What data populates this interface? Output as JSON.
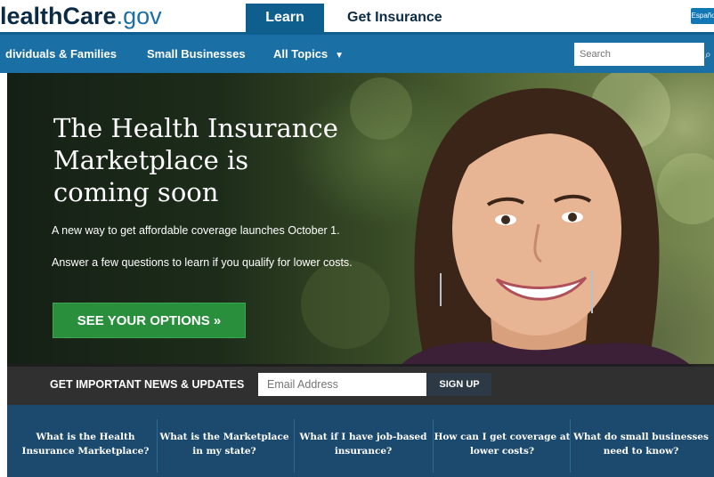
{
  "header": {
    "logo_part1": "lealthCare",
    "logo_part2": ".gov",
    "tabs": [
      {
        "label": "Learn",
        "active": true
      },
      {
        "label": "Get Insurance",
        "active": false
      }
    ],
    "language_button": "Español"
  },
  "nav": {
    "items": [
      {
        "label": "dividuals & Families"
      },
      {
        "label": "Small Businesses"
      },
      {
        "label": "All Topics"
      }
    ],
    "search_placeholder": "Search"
  },
  "hero": {
    "headline_1": "The Health Insurance",
    "headline_2": "Marketplace is",
    "headline_3": "coming soon",
    "line1": "A new way to get affordable coverage launches October 1.",
    "line2": "Answer a few questions to learn if you qualify for lower costs.",
    "cta_label": "SEE YOUR OPTIONS »"
  },
  "signup": {
    "label": "GET IMPORTANT NEWS & UPDATES",
    "email_placeholder": "Email Address",
    "button": "SIGN UP"
  },
  "questions": [
    {
      "label": "What is the Health Insurance Marketplace?"
    },
    {
      "label": "What is the Marketplace in my state?"
    },
    {
      "label": "What if I have job-based insurance?"
    },
    {
      "label": "How can I get coverage at lower costs?"
    },
    {
      "label": "What do small businesses need to know?"
    }
  ],
  "colors": {
    "nav_blue": "#1a6fa4",
    "tab_active": "#0f5f8e",
    "cta_green": "#2a8f3c",
    "questions_bg": "#1b4a6e"
  }
}
